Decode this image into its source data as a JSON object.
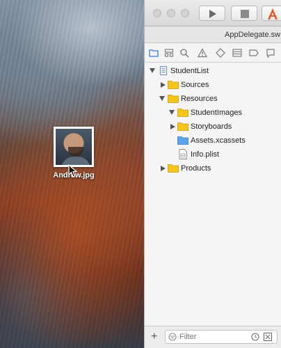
{
  "drag": {
    "file_name": "Andrew.jpg"
  },
  "xcode": {
    "tab_title": "AppDelegate.sw",
    "tree": [
      {
        "label": "StudentList",
        "icon": "project-icon",
        "expanded": true,
        "indent": 0
      },
      {
        "label": "Sources",
        "icon": "folder-icon",
        "expanded": false,
        "indent": 1
      },
      {
        "label": "Resources",
        "icon": "folder-icon",
        "expanded": true,
        "indent": 1
      },
      {
        "label": "StudentImages",
        "icon": "folder-icon",
        "expanded": true,
        "indent": 2
      },
      {
        "label": "Storyboards",
        "icon": "folder-icon",
        "expanded": false,
        "indent": 2
      },
      {
        "label": "Assets.xcassets",
        "icon": "asset-catalog-icon",
        "indent": 2
      },
      {
        "label": "Info.plist",
        "icon": "plist-file-icon",
        "indent": 2
      },
      {
        "label": "Products",
        "icon": "folder-icon",
        "expanded": false,
        "indent": 1
      }
    ],
    "filter": {
      "placeholder": "Filter"
    }
  },
  "colors": {
    "folder_yellow": "#f5c518",
    "asset_blue": "#5aa3e8"
  }
}
